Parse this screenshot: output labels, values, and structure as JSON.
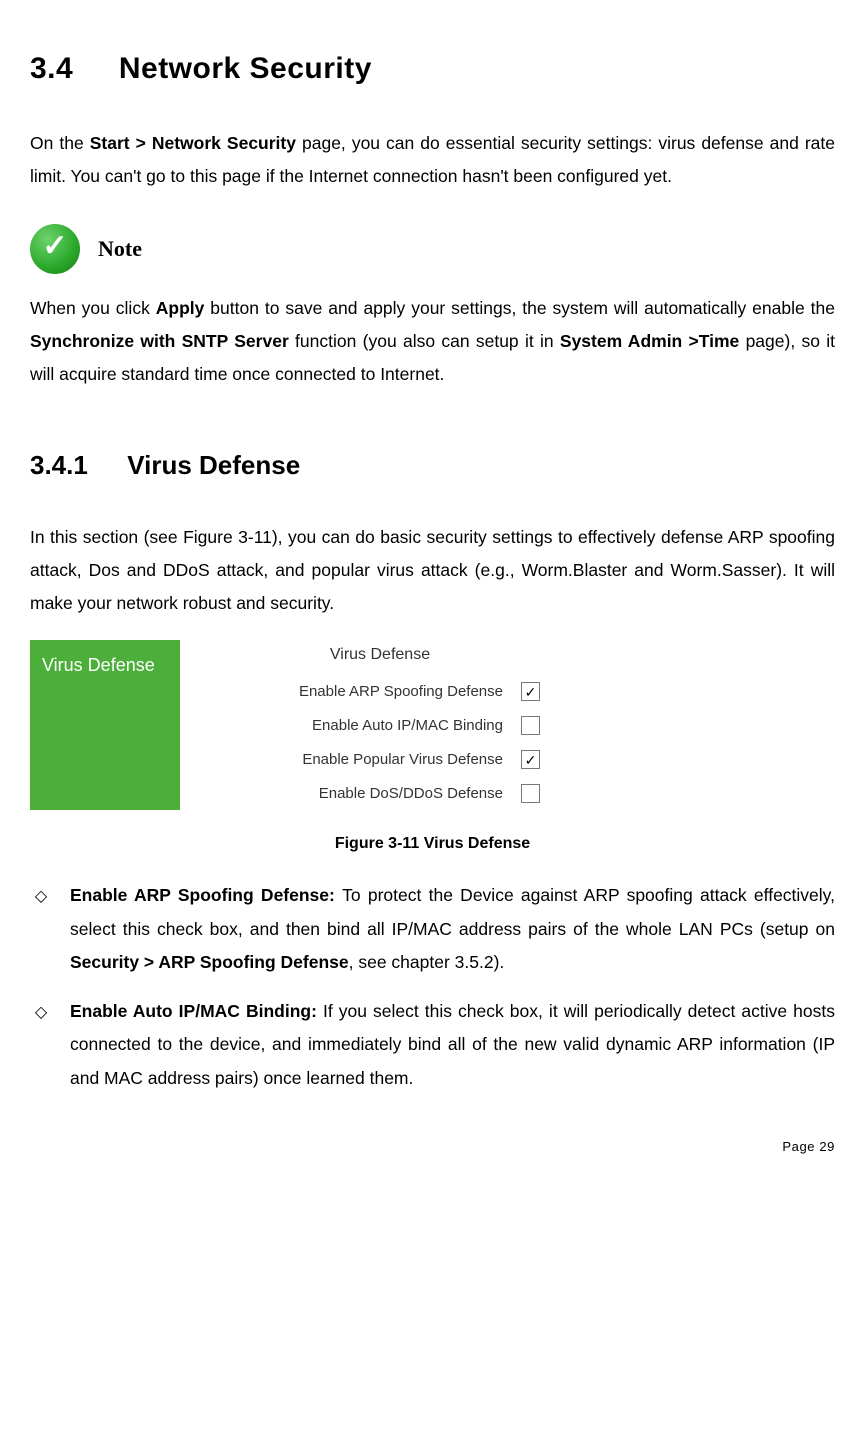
{
  "section": {
    "num": "3.4",
    "title": "Network Security"
  },
  "para1": {
    "lead": "On the ",
    "bold1": "Start > Network Security",
    "tail": " page, you can do essential security settings: virus defense and rate limit. You can't go to this page if the Internet connection hasn't been configured yet."
  },
  "note": {
    "label": "Note",
    "lead": "When you click ",
    "apply": "Apply",
    "mid1": " button to save and apply your settings, the system will automatically enable the ",
    "sync": "Synchronize with SNTP Server",
    "mid2": " function (you also can setup it in ",
    "sysadmin": "System Admin >Time",
    "tail": " page), so it will acquire standard time once connected to Internet."
  },
  "subsection": {
    "num": "3.4.1",
    "title": "Virus Defense"
  },
  "para2": "In this section (see Figure 3-11), you can do basic security settings to effectively defense ARP spoofing attack, Dos and DDoS attack, and popular virus attack (e.g., Worm.Blaster and Worm.Sasser). It will make your network robust and security.",
  "figure": {
    "chipLabel": "Virus Defense",
    "panelTitle": "Virus Defense",
    "rows": {
      "r1": {
        "label": "Enable ARP Spoofing Defense",
        "checked": true
      },
      "r2": {
        "label": "Enable Auto IP/MAC Binding",
        "checked": false
      },
      "r3": {
        "label": "Enable Popular Virus Defense",
        "checked": true
      },
      "r4": {
        "label": "Enable DoS/DDoS Defense",
        "checked": false
      }
    },
    "caption": "Figure 3-11 Virus Defense"
  },
  "bullet1": {
    "diamond": "◇",
    "title": "Enable ARP Spoofing Defense: ",
    "body1": "To protect the Device against ARP spoofing attack effectively, select this check box, and then bind all IP/MAC address pairs of the whole LAN PCs (setup on ",
    "bold": "Security > ARP Spoofing Defense",
    "body2": ", see chapter 3.5.2)."
  },
  "bullet2": {
    "diamond": "◇",
    "title": "Enable Auto IP/MAC Binding: ",
    "body": "If you select this check box, it will periodically detect active hosts connected to the device, and immediately bind all of the new valid dynamic ARP information (IP and MAC address pairs) once learned them."
  },
  "pageNum": "Page 29",
  "glyphs": {
    "check": "✓"
  }
}
